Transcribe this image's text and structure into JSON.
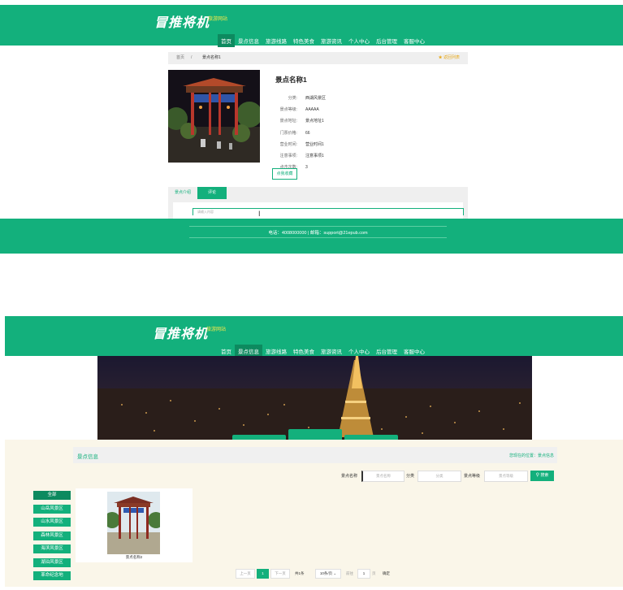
{
  "top": {
    "logo": "冒推将机",
    "logo_sub": "旅游网站",
    "nav": [
      "首页",
      "景点信息",
      "旅游线路",
      "特色美食",
      "旅游资讯",
      "个人中心",
      "后台管理",
      "客服中心"
    ],
    "nav_active_index": 0,
    "breadcrumb_home": "首页",
    "breadcrumb_sep": "/",
    "breadcrumb_current": "景点名称1",
    "back_button": "★ 返回列表",
    "detail": {
      "title": "景点名称1",
      "fields": [
        {
          "label": "分类:",
          "value": "西湖风景区"
        },
        {
          "label": "景点等级:",
          "value": "AAAAA"
        },
        {
          "label": "景点地址:",
          "value": "景点地址1"
        },
        {
          "label": "门票价格:",
          "value": "66"
        },
        {
          "label": "营业时间:",
          "value": "营业时间1"
        },
        {
          "label": "注意事项:",
          "value": "注意事项1"
        },
        {
          "label": "点击次数:",
          "value": "3"
        }
      ],
      "favorite_button": "点我收藏"
    },
    "tabs": [
      "景点介绍",
      "评论"
    ],
    "tab_active_index": 1,
    "comment_placeholder": "请输入内容",
    "footer": "电话：4008000000 | 邮箱：support@21epub.com"
  },
  "bottom": {
    "logo": "冒推将机",
    "logo_sub": "旅游网站",
    "nav": [
      "首页",
      "景点信息",
      "旅游线路",
      "特色美食",
      "旅游资讯",
      "个人中心",
      "后台管理",
      "客服中心"
    ],
    "nav_active_index": 1,
    "section_title": "景点信息",
    "location_text": "您现在的位置：景点信息",
    "search": {
      "name_label": "景点名称",
      "name_placeholder": "景点名称",
      "category_label": "分类",
      "category_placeholder": "分类",
      "level_label": "景点等级",
      "level_placeholder": "景点等级",
      "search_button": "搜索"
    },
    "categories": [
      "全部",
      "山岳风景区",
      "山水风景区",
      "森林风景区",
      "海滨风景区",
      "湖泊风景区",
      "革命纪念地"
    ],
    "category_active_index": 0,
    "card_name": "景点名称2",
    "pagination": {
      "prev": "上一页",
      "current": "1",
      "next": "下一页",
      "total": "共1条",
      "page_size": "10条/页",
      "goto_label": "前往",
      "goto_value": "1",
      "page_unit": "页",
      "confirm": "确定"
    }
  },
  "colors": {
    "brand": "#13b07c",
    "brand_dark": "#0d8a5f",
    "accent_yellow": "#f7e84a"
  }
}
